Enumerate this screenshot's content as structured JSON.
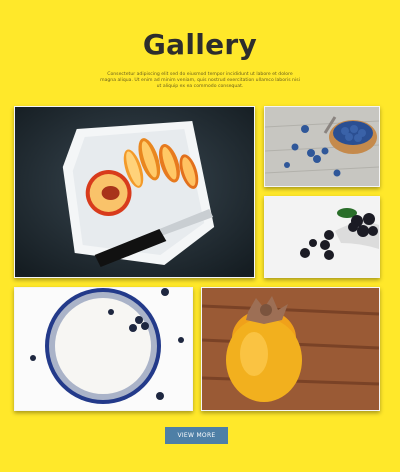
{
  "header": {
    "title": "Gallery",
    "description": "Consectetur adipiscing elit sed do eiusmod tempor incididunt ut labore et dolore magna aliqua. Ut enim ad minim veniam, quis nostrud exercitation ullamco laboris nisi ut aliquip ex ea commodo consequat."
  },
  "gallery": {
    "photos": [
      {
        "subject": "peach-plate"
      },
      {
        "subject": "blueberries"
      },
      {
        "subject": "blackberries"
      },
      {
        "subject": "yogurt-bowl"
      },
      {
        "subject": "persimmon"
      }
    ]
  },
  "actions": {
    "view_more_label": "VIEW MORE"
  },
  "colors": {
    "background": "#ffe82a",
    "button": "#4e7fa6",
    "title": "#2d2d2d"
  }
}
